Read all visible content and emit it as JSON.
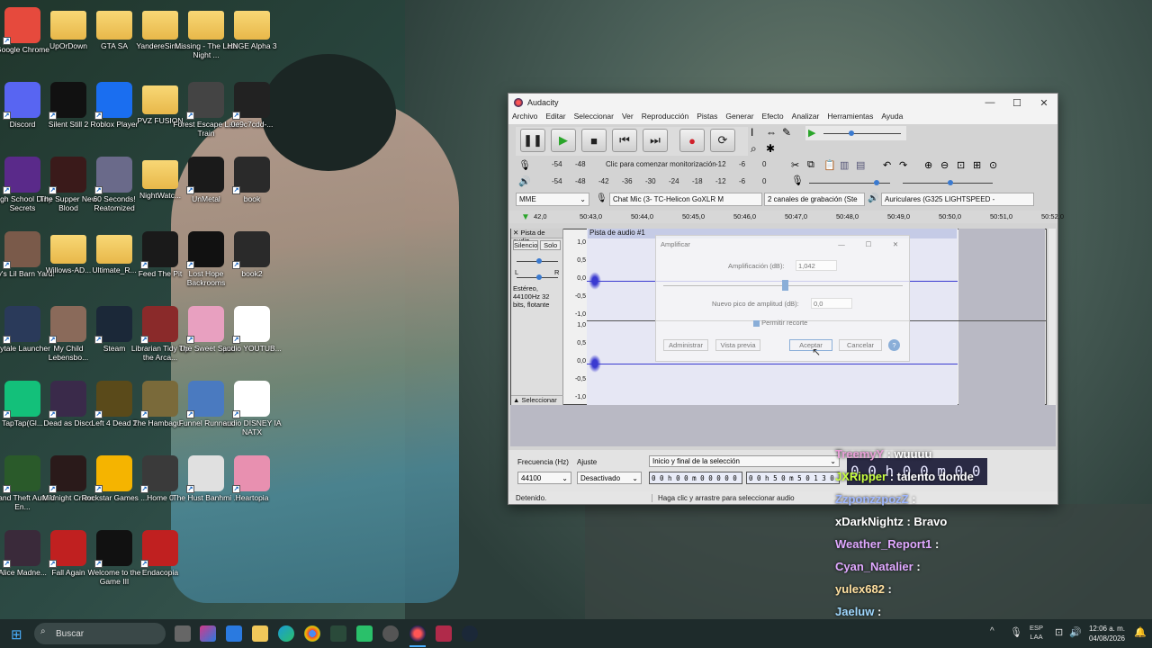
{
  "desktop_icons": [
    {
      "label": "Google Chrome",
      "icon": "chrome-icon",
      "color": "#e64a3d"
    },
    {
      "label": "UpOrDown",
      "icon": "folder-icon",
      "color": "#f0c85a"
    },
    {
      "label": "GTA SA",
      "icon": "folder-icon",
      "color": "#f0c85a"
    },
    {
      "label": "YandereSim...",
      "icon": "folder-icon",
      "color": "#f0c85a"
    },
    {
      "label": "Missing - The Late Night ...",
      "icon": "folder-icon",
      "color": "#f0c85a"
    },
    {
      "label": "HNGE Alpha 3",
      "icon": "folder-icon",
      "color": "#f0c85a"
    },
    {
      "label": "Discord",
      "icon": "discord-icon",
      "color": "#5865f2"
    },
    {
      "label": "Silent Still 2",
      "icon": "game-icon",
      "color": "#111111"
    },
    {
      "label": "Roblox Player",
      "icon": "roblox-icon",
      "color": "#1a6ef0"
    },
    {
      "label": "PVZ FUSION",
      "icon": "folder-icon",
      "color": "#f0c85a"
    },
    {
      "label": "Forest Escape Last Train",
      "icon": "game-icon",
      "color": "#444444"
    },
    {
      "label": "0e9c7cdd-...",
      "icon": "game-icon",
      "color": "#222222"
    },
    {
      "label": "High School Dirty Secrets",
      "icon": "game-icon",
      "color": "#5a2a8a"
    },
    {
      "label": "The Supper New Blood",
      "icon": "game-icon",
      "color": "#3a1a1a"
    },
    {
      "label": "60 Seconds! Reatomized",
      "icon": "game-icon",
      "color": "#6a6a8a"
    },
    {
      "label": "NightWatc...",
      "icon": "folder-icon",
      "color": "#f0c85a"
    },
    {
      "label": "UnMetal",
      "icon": "game-icon",
      "color": "#1a1a1a"
    },
    {
      "label": "book",
      "icon": "game-icon",
      "color": "#2a2a2a"
    },
    {
      "label": "Lily's Lil Barn Yard!",
      "icon": "game-icon",
      "color": "#7a5a4a"
    },
    {
      "label": "Willows-AD...",
      "icon": "folder-icon",
      "color": "#f0c85a"
    },
    {
      "label": "Ultimate_R...",
      "icon": "folder-icon",
      "color": "#f0c85a"
    },
    {
      "label": "Feed The Pit",
      "icon": "game-icon",
      "color": "#1a1a1a"
    },
    {
      "label": "Lost Hope Backrooms",
      "icon": "unity-icon",
      "color": "#111111"
    },
    {
      "label": "book2",
      "icon": "game-icon",
      "color": "#2a2a2a"
    },
    {
      "label": "Hytale Launcher",
      "icon": "game-icon",
      "color": "#2a3a5a"
    },
    {
      "label": "My Child Lebensbo...",
      "icon": "game-icon",
      "color": "#8a6a5a"
    },
    {
      "label": "Steam",
      "icon": "steam-icon",
      "color": "#1b2838"
    },
    {
      "label": "Librarian Tidy Up the Arca...",
      "icon": "game-icon",
      "color": "#8a2a2a"
    },
    {
      "label": "The Sweet Spot",
      "icon": "game-icon",
      "color": "#e8a0c0"
    },
    {
      "label": "audio YOUTUB...",
      "icon": "media-file-icon",
      "color": "#ffffff"
    },
    {
      "label": "TapTap(Gl...",
      "icon": "taptap-icon",
      "color": "#13c07a"
    },
    {
      "label": "Dead as Disco",
      "icon": "game-icon",
      "color": "#3a2a4a"
    },
    {
      "label": "Left 4 Dead 2",
      "icon": "game-icon",
      "color": "#5a4a1a"
    },
    {
      "label": "The Hambagu...",
      "icon": "game-icon",
      "color": "#7a6a3a"
    },
    {
      "label": "Funnel Runners",
      "icon": "game-icon",
      "color": "#4a7ac0"
    },
    {
      "label": "audio DISNEY IA NATX",
      "icon": "media-file-icon",
      "color": "#ffffff"
    },
    {
      "label": "Grand Theft Auto V En...",
      "icon": "gta-icon",
      "color": "#2a5a2a"
    },
    {
      "label": "Midnight Crane",
      "icon": "game-icon",
      "color": "#2a1a1a"
    },
    {
      "label": "Rockstar Games ...",
      "icon": "rockstar-icon",
      "color": "#f5b400"
    },
    {
      "label": "Home 0",
      "icon": "game-icon",
      "color": "#3a3a3a"
    },
    {
      "label": "The Hust Banhmi ...",
      "icon": "game-icon",
      "color": "#e0e0e0"
    },
    {
      "label": "Heartopia",
      "icon": "game-icon",
      "color": "#e890b0"
    },
    {
      "label": "Alice Madne...",
      "icon": "game-icon",
      "color": "#3a2a3a"
    },
    {
      "label": "Fall Again",
      "icon": "game-icon",
      "color": "#c02020"
    },
    {
      "label": "Welcome to the Game III",
      "icon": "game-icon",
      "color": "#111111"
    },
    {
      "label": "Endacopia",
      "icon": "game-icon",
      "color": "#c02020"
    }
  ],
  "audacity": {
    "title": "Audacity",
    "menu": [
      "Archivo",
      "Editar",
      "Seleccionar",
      "Ver",
      "Reproducción",
      "Pistas",
      "Generar",
      "Efecto",
      "Analizar",
      "Herramientas",
      "Ayuda"
    ],
    "meter_ticks": [
      "-54",
      "-48",
      "-42",
      "-36",
      "-30",
      "-24",
      "-18",
      "-12",
      "-6",
      "0"
    ],
    "meter_msg": "Clic para comenzar monitorización",
    "meter_ticks_short": [
      "-12",
      "-6",
      "0"
    ],
    "host": "MME",
    "rec_device": "Chat Mic (3- TC-Helicon GoXLR M",
    "channels": "2 canales de grabación (Ste",
    "play_device": "Auriculares (G325 LIGHTSPEED -",
    "ruler": [
      "42,0",
      "50:43,0",
      "50:44,0",
      "50:45,0",
      "50:46,0",
      "50:47,0",
      "50:48,0",
      "50:49,0",
      "50:50,0",
      "50:51,0",
      "50:52,0"
    ],
    "track_name": "Pista de audi",
    "clip_name": "Pista de audio #1",
    "silence": "Silencio",
    "solo": "Solo",
    "track_format": "Estéreo, 44100Hz 32 bits, flotante",
    "select_btn": "Seleccionar",
    "scale": [
      "1,0",
      "0,5",
      "0,0",
      "-0,5",
      "-1,0"
    ],
    "rate_label": "Frecuencia (Hz)",
    "rate_value": "44100",
    "snap_label": "Ajuste",
    "snap_value": "Desactivado",
    "sel_label": "Inicio y final de la selección",
    "sel_start": "0 0 h 0 0 m 0 0 0 0 0 s",
    "sel_end": "0 0 h 5 0 m 5 0 1 3 0 s",
    "big_time": "0 0 h 0 0 m 0 0 s",
    "status_left": "Detenido.",
    "status_mid": "Haga clic y arrastre para seleccionar audio"
  },
  "dialog": {
    "title": "Amplificar",
    "amp_label": "Amplificación (dB):",
    "amp_value": "1,042",
    "peak_label": "Nuevo pico de amplitud (dB):",
    "peak_value": "0,0",
    "clip_label": "Permitir recorte",
    "manage": "Administrar",
    "preview": "Vista previa",
    "ok": "Aceptar",
    "cancel": "Cancelar",
    "help": "?"
  },
  "chat": [
    {
      "user": "TreemyY",
      "msg": "wuuuu",
      "color": "#e8a0d8"
    },
    {
      "user": "JXRipper",
      "msg": "talento donde",
      "color": "#c8ff40"
    },
    {
      "user": "ZzponzzpozZ",
      "msg": "",
      "color": "#a0b8ff"
    },
    {
      "user": "xDarkNightz",
      "msg": "Bravo",
      "color": "#ffffff"
    },
    {
      "user": "Weather_Report1",
      "msg": "",
      "color": "#e0a8ff"
    },
    {
      "user": "Cyan_Natalier",
      "msg": "",
      "color": "#e0a8ff"
    },
    {
      "user": "yulex682",
      "msg": "",
      "color": "#ffe0a0"
    },
    {
      "user": "Jaeluw",
      "msg": "",
      "color": "#a0d8ff"
    }
  ],
  "taskbar": {
    "search": "Buscar",
    "lang1": "ESP",
    "lang2": "LAA",
    "time": "12:06 a. m.",
    "date": "04/08/2026"
  }
}
